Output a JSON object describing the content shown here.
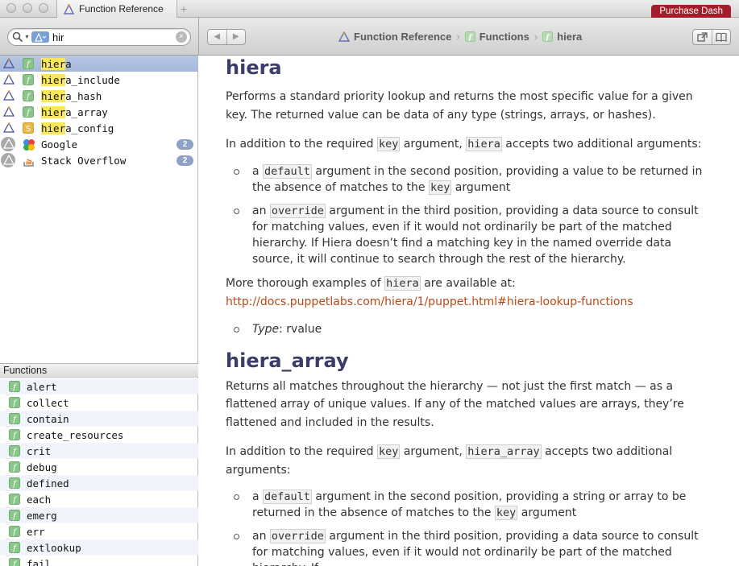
{
  "window": {
    "tab_title": "Function Reference",
    "tab_add": "+",
    "purchase_label": "Purchase Dash"
  },
  "toolbar": {
    "search_value": "hir",
    "clear_glyph": "×",
    "back_glyph": "◀",
    "forward_glyph": "▶",
    "breadcrumbs": [
      "Function Reference",
      "Functions",
      "hiera"
    ],
    "breadcrumb_sep": "›"
  },
  "results": [
    {
      "name_hl": "hier",
      "name_rest": "a",
      "kind": "f"
    },
    {
      "name_hl": "hier",
      "name_rest": "a_include",
      "kind": "f"
    },
    {
      "name_hl": "hier",
      "name_rest": "a_hash",
      "kind": "f"
    },
    {
      "name_hl": "hier",
      "name_rest": "a_array",
      "kind": "f"
    },
    {
      "name_hl": "hier",
      "name_rest": "a_config",
      "kind": "S"
    },
    {
      "name": "Google",
      "badge": "2"
    },
    {
      "name": "Stack Overflow",
      "badge": "2"
    }
  ],
  "functions_header": "Functions",
  "functions": [
    "alert",
    "collect",
    "contain",
    "create_resources",
    "crit",
    "debug",
    "defined",
    "each",
    "emerg",
    "err",
    "extlookup",
    "fail"
  ],
  "content": {
    "hiera": {
      "title": "hiera",
      "p1": "Performs a standard priority lookup and returns the most specific value for a given key. The returned value can be data of any type (strings, arrays, or hashes).",
      "p2_a": "In addition to the required ",
      "p2_code1": "key",
      "p2_b": " argument, ",
      "p2_code2": "hiera",
      "p2_c": " accepts two additional arguments:",
      "li1_a": "a ",
      "li1_code1": "default",
      "li1_b": " argument in the second position, providing a value to be returned in the absence of matches to the ",
      "li1_code2": "key",
      "li1_c": " argument",
      "li2_a": "an ",
      "li2_code": "override",
      "li2_b": " argument in the third position, providing a data source to consult for matching values, even if it would not ordinarily be part of the matched hierarchy. If Hiera doesn’t find a matching key in the named override data source, it will continue to search through the rest of the hierarchy.",
      "p3_a": "More thorough examples of ",
      "p3_code": "hiera",
      "p3_b": " are available at:",
      "link": "http://docs.puppetlabs.com/hiera/1/puppet.html#hiera-lookup-functions",
      "type_label": "Type",
      "type_value": ": rvalue"
    },
    "hiera_array": {
      "title": "hiera_array",
      "p1": "Returns all matches throughout the hierarchy — not just the first match — as a flattened array of unique values. If any of the matched values are arrays, they’re flattened and included in the results.",
      "p2_a": "In addition to the required ",
      "p2_code1": "key",
      "p2_b": " argument, ",
      "p2_code2": "hiera_array",
      "p2_c": " accepts two additional arguments:",
      "li1_a": "a ",
      "li1_code1": "default",
      "li1_b": " argument in the second position, providing a string or array to be returned in the absence of matches to the ",
      "li1_code2": "key",
      "li1_c": " argument",
      "li2_a": "an ",
      "li2_code": "override",
      "li2_b": " argument in the third position, providing a data source to consult for matching values, even if it would not ordinarily be part of the matched hierarchy. If"
    }
  },
  "colors": {
    "selection": "#a5b8db",
    "heading": "#3c3c6a",
    "link": "#b64a1a",
    "badge": "#8fa1c6",
    "purchase": "#a31e2a",
    "function_icon": "#8cc58a",
    "setting_icon": "#e6b94a"
  }
}
